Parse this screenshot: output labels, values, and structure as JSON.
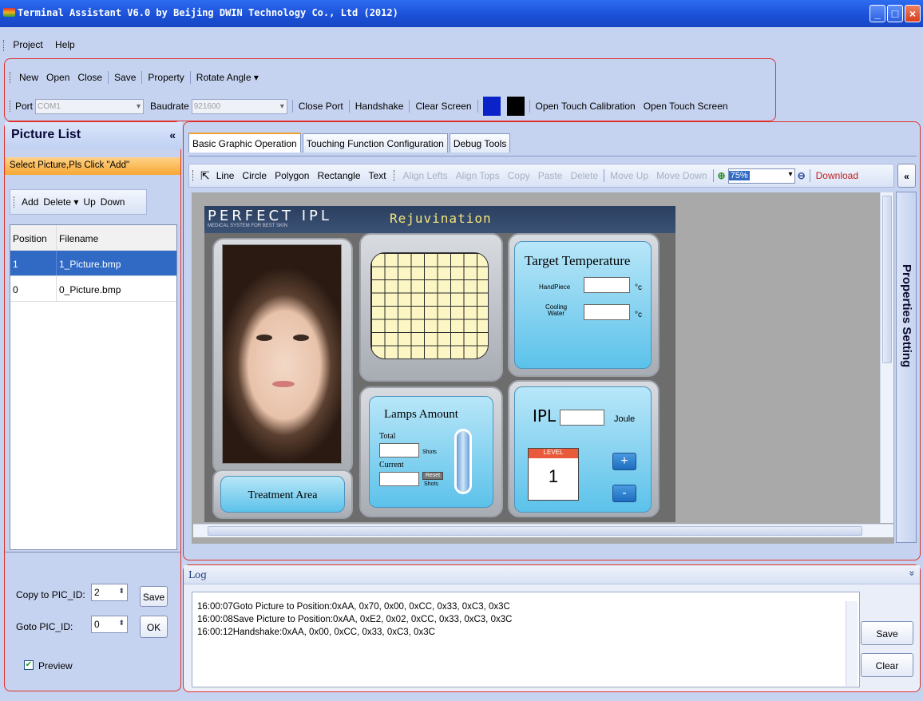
{
  "window": {
    "title": "Terminal Assistant V6.0 by Beijing DWIN Technology Co., Ltd (2012)"
  },
  "menu": {
    "items": [
      "Project",
      "Help"
    ]
  },
  "toolbar1": {
    "new": "New",
    "open": "Open",
    "close": "Close",
    "save": "Save",
    "property": "Property",
    "rotate": "Rotate Angle"
  },
  "toolbar2": {
    "port_label": "Port",
    "port_value": "COM1",
    "baud_label": "Baudrate",
    "baud_value": "921600",
    "close_port": "Close Port",
    "handshake": "Handshake",
    "clear_screen": "Clear Screen",
    "open_touch_cal": "Open Touch Calibration",
    "open_touch_screen": "Open Touch Screen",
    "swatch1": "#0a23c8",
    "swatch2": "#000000"
  },
  "picture_list": {
    "title": "Picture List",
    "collapse": "«",
    "hint": "Select Picture,Pls Click \"Add\"",
    "buttons": {
      "add": "Add",
      "delete": "Delete",
      "up": "Up",
      "down": "Down"
    },
    "columns": [
      "Position",
      "Filename"
    ],
    "rows": [
      {
        "position": "1",
        "filename": "1_Picture.bmp"
      },
      {
        "position": "0",
        "filename": "0_Picture.bmp"
      }
    ],
    "copy_label": "Copy to PIC_ID:",
    "copy_value": "2",
    "save": "Save",
    "goto_label": "Goto PIC_ID:",
    "goto_value": "0",
    "ok": "OK",
    "preview": "Preview"
  },
  "tabs": [
    "Basic Graphic Operation",
    "Touching Function Configuration",
    "Debug Tools"
  ],
  "drawbar": {
    "line": "Line",
    "circle": "Circle",
    "polygon": "Polygon",
    "rectangle": "Rectangle",
    "text": "Text",
    "align_lefts": "Align Lefts",
    "align_tops": "Align Tops",
    "copy": "Copy",
    "paste": "Paste",
    "delete": "Delete",
    "move_up": "Move Up",
    "move_down": "Move Down",
    "zoom": "75%",
    "download": "Download",
    "collapse": "«"
  },
  "side_panel": {
    "label": "Properties Setting"
  },
  "picture": {
    "brand": "PERFECT IPL",
    "brand_sub": "MEDICAL SYSTEM FOR BEST SKIN",
    "title": "Rejuvination",
    "target_temp": "Target Temperature",
    "handpiece": "HandPiece",
    "cooling": "Cooling",
    "water": "Water",
    "unit": "°c",
    "lamps": "Lamps Amount",
    "total": "Total",
    "current": "Current",
    "shots": "Shots",
    "reset": "Reset",
    "ipl": "IPL",
    "joule": "Joule",
    "level": "LEVEL",
    "level_value": "1",
    "plus": "+",
    "minus": "-",
    "treatment": "Treatment Area"
  },
  "log": {
    "title": "Log",
    "lines": [
      "16:00:07Goto Picture to Position:0xAA, 0x70, 0x00, 0xCC, 0x33, 0xC3, 0x3C",
      "16:00:08Save Picture to Position:0xAA, 0xE2, 0x02, 0xCC, 0x33, 0xC3, 0x3C",
      "16:00:12Handshake:0xAA, 0x00, 0xCC, 0x33, 0xC3, 0x3C"
    ],
    "save": "Save",
    "clear": "Clear",
    "collapse": "»"
  }
}
